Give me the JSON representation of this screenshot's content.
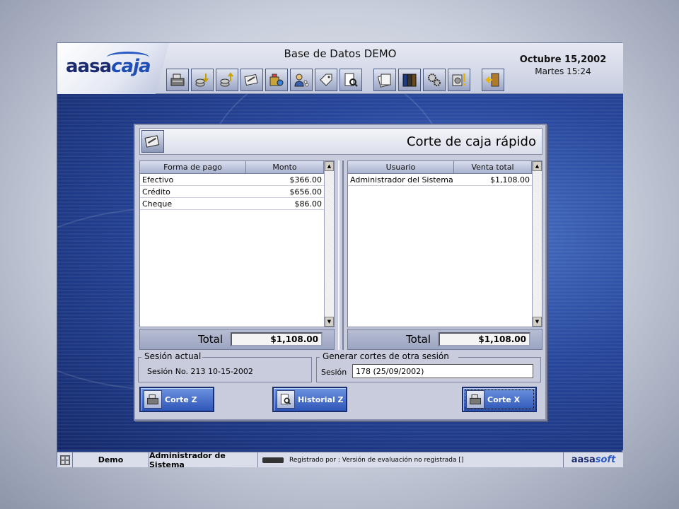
{
  "header": {
    "logo_main": "aasa",
    "logo_accent": "caja",
    "db_title": "Base de Datos DEMO",
    "date": "Octubre 15,2002",
    "time": "Martes  15:24"
  },
  "toolbar": {
    "buttons": [
      {
        "name": "cash-register-icon"
      },
      {
        "name": "coins-in-icon"
      },
      {
        "name": "coins-out-icon"
      },
      {
        "name": "cash-cut-icon"
      },
      {
        "name": "products-icon"
      },
      {
        "name": "customers-icon"
      },
      {
        "name": "tags-icon"
      },
      {
        "name": "search-document-icon"
      },
      {
        "name": "documents-icon"
      },
      {
        "name": "books-icon"
      },
      {
        "name": "gears-icon"
      },
      {
        "name": "config-alert-icon"
      },
      {
        "name": "exit-door-icon"
      }
    ]
  },
  "dialog": {
    "title": "Corte de caja rápido",
    "left_grid": {
      "columns": [
        "Forma de pago",
        "Monto"
      ],
      "rows": [
        [
          "Efectivo",
          "$366.00"
        ],
        [
          "Crédito",
          "$656.00"
        ],
        [
          "Cheque",
          "$86.00"
        ]
      ],
      "total_label": "Total",
      "total_value": "$1,108.00"
    },
    "right_grid": {
      "columns": [
        "Usuario",
        "Venta total"
      ],
      "rows": [
        [
          "Administrador del Sistema",
          "$1,108.00"
        ]
      ],
      "total_label": "Total",
      "total_value": "$1,108.00"
    },
    "session_group": {
      "legend": "Sesión actual",
      "text": "Sesión No. 213 10-15-2002"
    },
    "other_session_group": {
      "legend": "Generar cortes de otra sesión",
      "label": "Sesión",
      "value": "178 (25/09/2002)"
    },
    "buttons": {
      "corte_z": "Corte Z",
      "historial_z": "Historial Z",
      "corte_x": "Corte X"
    }
  },
  "status_bar": {
    "mode": "Demo",
    "user": "Administrador de Sistema",
    "registration": "Registrado por : Versión de evaluación no registrada  []",
    "brand_main": "aasa",
    "brand_accent": "soft"
  },
  "colors": {
    "workspace_blue": "#27479c",
    "button_blue": "#2e56b8",
    "dialog_bg": "#c8ccdc"
  }
}
